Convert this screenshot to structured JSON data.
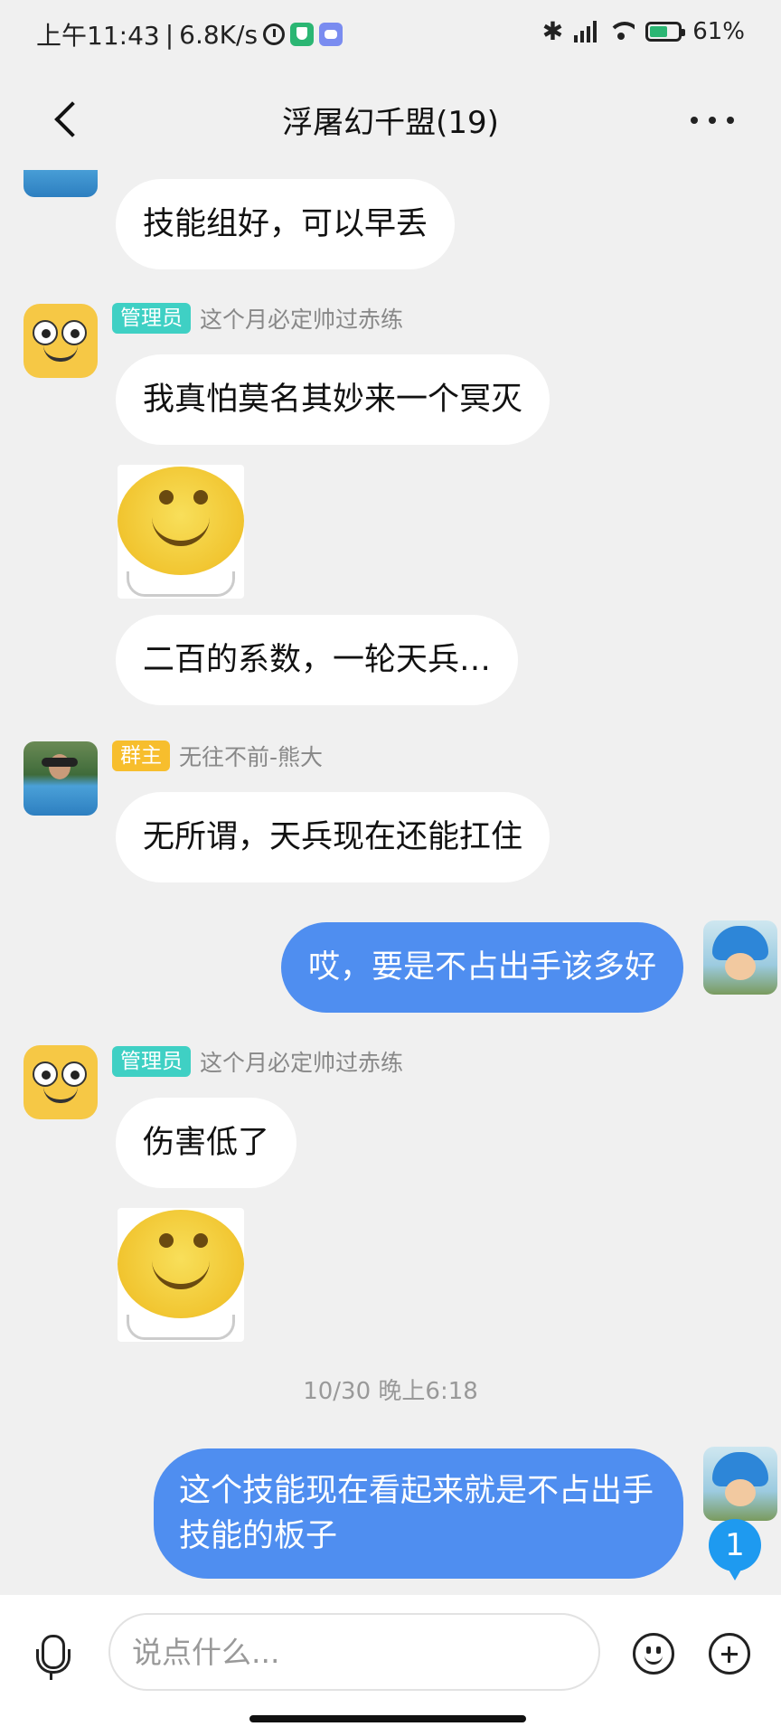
{
  "status_bar": {
    "time": "上午11:43",
    "net_speed": "6.8K/s",
    "battery_level": 0.61,
    "battery_text": "61%"
  },
  "header": {
    "title": "浮屠幻千盟(19)"
  },
  "messages": [
    {
      "kind": "text",
      "side": "left",
      "text": "技能组好，可以早丢"
    },
    {
      "kind": "sender",
      "badge": "管理员",
      "name": "这个月必定帅过赤练"
    },
    {
      "kind": "text",
      "side": "left",
      "text": "我真怕莫名其妙来一个冥灭"
    },
    {
      "kind": "sticker",
      "side": "left"
    },
    {
      "kind": "text",
      "side": "left",
      "text": "二百的系数，一轮天兵…"
    },
    {
      "kind": "sender",
      "badge": "群主",
      "name": "无往不前-熊大"
    },
    {
      "kind": "text",
      "side": "left",
      "text": "无所谓，天兵现在还能扛住"
    },
    {
      "kind": "text",
      "side": "right",
      "text": "哎，要是不占出手该多好"
    },
    {
      "kind": "sender",
      "badge": "管理员",
      "name": "这个月必定帅过赤练"
    },
    {
      "kind": "text",
      "side": "left",
      "text": "伤害低了"
    },
    {
      "kind": "sticker",
      "side": "left"
    },
    {
      "kind": "time",
      "text": "10/30 晚上6:18"
    },
    {
      "kind": "text",
      "side": "right",
      "text": "这个技能现在看起来就是不占出手技能的板子"
    }
  ],
  "unread_count": "1",
  "input": {
    "placeholder": "说点什么..."
  },
  "colors": {
    "mine_bubble": "#4f8ef0",
    "admin_badge": "#3fd0c4",
    "owner_badge": "#f7be2d",
    "unread_badge": "#1e9af0"
  }
}
